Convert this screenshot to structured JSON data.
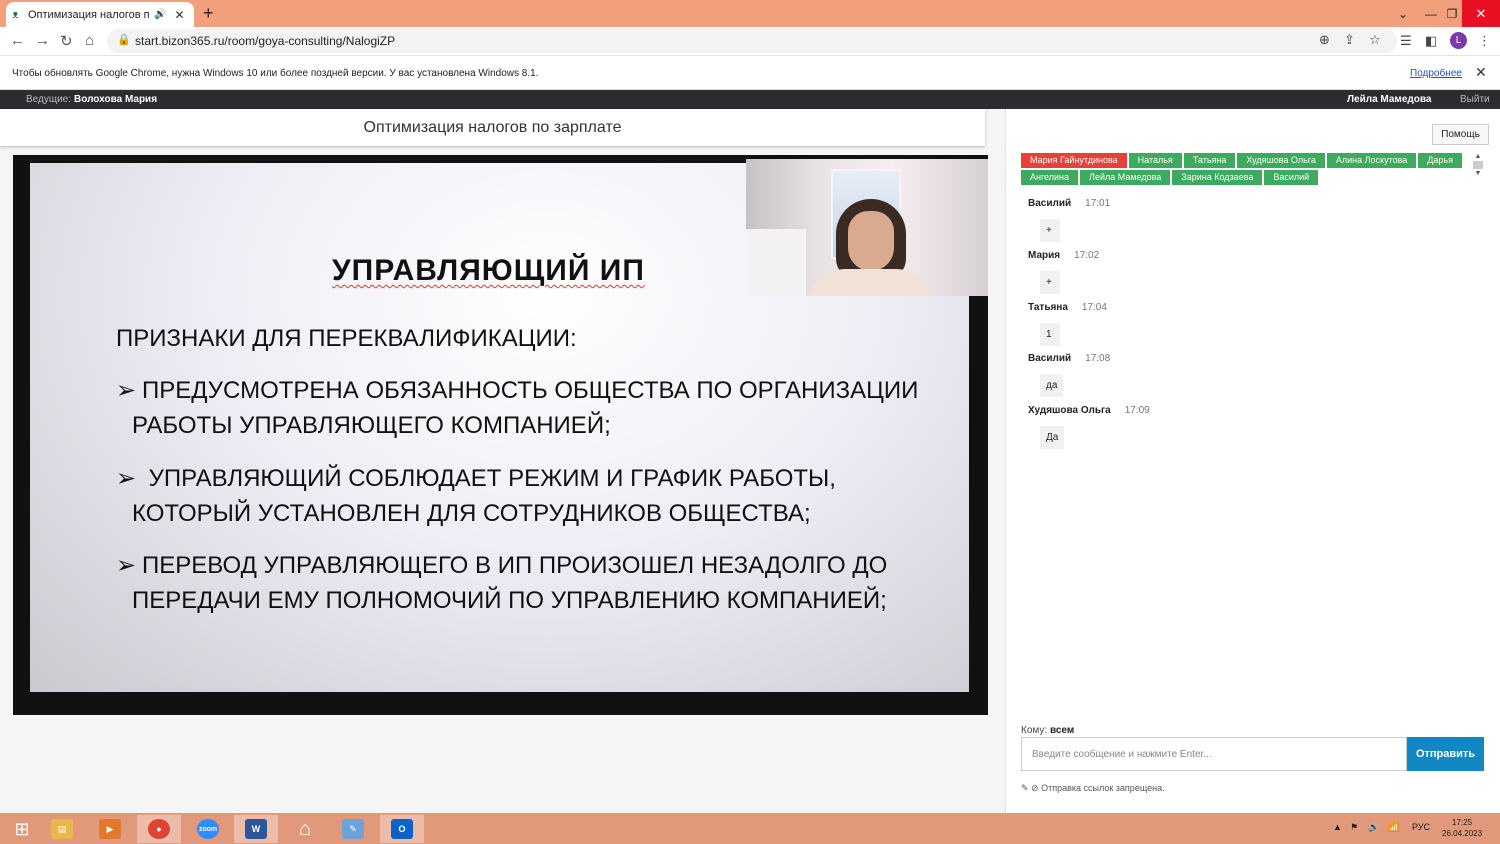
{
  "browser": {
    "tab_title": "Оптимизация налогов по з",
    "url": "start.bizon365.ru/room/goya-consulting/NalogiZP",
    "profile_letter": "L"
  },
  "infobar": {
    "message": "Чтобы обновлять Google Chrome, нужна Windows 10 или более поздней версии. У вас установлена Windows 8.1.",
    "more_link": "Подробнее"
  },
  "room": {
    "host_label": "Ведущие:",
    "host_name": "Волохова Мария",
    "current_user": "Лейла Мамедова",
    "exit_label": "Выйти",
    "title": "Оптимизация налогов по зарплате"
  },
  "slide": {
    "title": "УПРАВЛЯЮЩИЙ ИП",
    "subtitle": "ПРИЗНАКИ ДЛЯ ПЕРЕКВАЛИФИКАЦИИ:",
    "bullets": [
      {
        "arrow": "➢",
        "line1": "ПРЕДУСМОТРЕНА ОБЯЗАННОСТЬ ОБЩЕСТВА ПО ОРГАНИЗАЦИИ",
        "line2": "РАБОТЫ УПРАВЛЯЮЩЕГО КОМПАНИЕЙ;"
      },
      {
        "arrow": "➢",
        "line1": " УПРАВЛЯЮЩИЙ СОБЛЮДАЕТ РЕЖИМ И ГРАФИК РАБОТЫ,",
        "line2": "КОТОРЫЙ УСТАНОВЛЕН ДЛЯ СОТРУДНИКОВ ОБЩЕСТВА;"
      },
      {
        "arrow": "➢",
        "line1": "ПЕРЕВОД УПРАВЛЯЮЩЕГО В ИП ПРОИЗОШЕЛ НЕЗАДОЛГО ДО",
        "line2": "ПЕРЕДАЧИ ЕМУ ПОЛНОМОЧИЙ ПО УПРАВЛЕНИЮ КОМПАНИЕЙ;"
      }
    ]
  },
  "chat": {
    "help_label": "Помощь",
    "participants": [
      {
        "name": "Мария Гайнутдинова",
        "color": "red"
      },
      {
        "name": "Наталья",
        "color": "green"
      },
      {
        "name": "Татьяна",
        "color": "green"
      },
      {
        "name": "Худяшова Ольга",
        "color": "green"
      },
      {
        "name": "Алина Лоскутова",
        "color": "green"
      },
      {
        "name": "Дарья",
        "color": "green"
      },
      {
        "name": "Ангелина",
        "color": "green"
      },
      {
        "name": "Лейла Мамедова",
        "color": "green"
      },
      {
        "name": "Зарина Кодзаева",
        "color": "green"
      },
      {
        "name": "Василий",
        "color": "green"
      }
    ],
    "messages": [
      {
        "author": "Василий",
        "time": "17:01",
        "text": "+"
      },
      {
        "author": "Мария",
        "time": "17:02",
        "text": "+"
      },
      {
        "author": "Татьяна",
        "time": "17:04",
        "text": "1"
      },
      {
        "author": "Василий",
        "time": "17:08",
        "text": "да"
      },
      {
        "author": "Худяшова Ольга",
        "time": "17:09",
        "text": "Да"
      }
    ],
    "to_label": "Кому:",
    "to_value": "всем",
    "input_placeholder": "Введите сообщение и нажмите Enter...",
    "send_label": "Отправить",
    "links_notice": "Отправка ссылок запрещена."
  },
  "taskbar": {
    "zoom_label": "zoom",
    "lang": "РУС",
    "time": "17:25",
    "date": "26.04.2023"
  }
}
